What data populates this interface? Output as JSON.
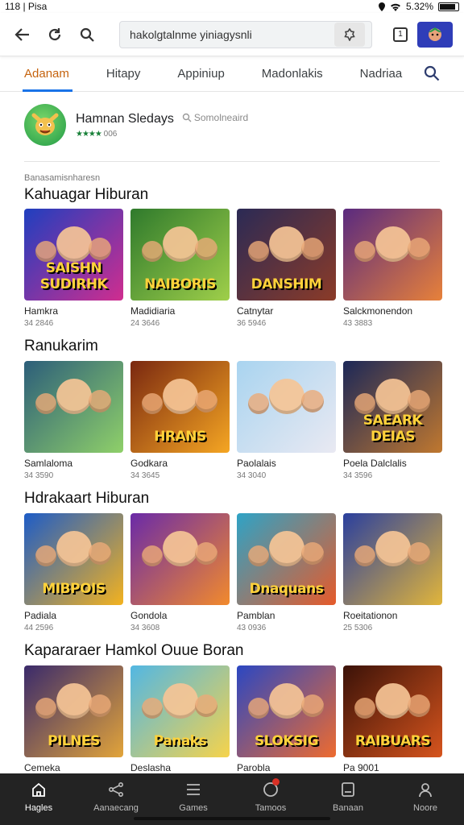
{
  "status_bar": {
    "time": "118 | Pisa",
    "battery": "5.32%"
  },
  "browser": {
    "url_text": "hakolgtalnme yiniagysnli",
    "tab_count": "1"
  },
  "tabs": [
    {
      "label": "Adanam"
    },
    {
      "label": "Hitapy"
    },
    {
      "label": "Appiniup"
    },
    {
      "label": "Madonlakis"
    },
    {
      "label": "Nadriaa"
    }
  ],
  "app": {
    "name": "Hamnan Sledays",
    "search_hint": "Somolneaird",
    "rating_count": "006"
  },
  "breadcrumb": "Banasamisnharesn",
  "sections": [
    {
      "title": "Kahuagar Hiburan",
      "items": [
        {
          "name": "Hamkra",
          "meta": "34 2846",
          "art": "SAISHN SUDIRHK",
          "bg1": "#1f3fbf",
          "bg2": "#d02d8f"
        },
        {
          "name": "Madidiaria",
          "meta": "24 3646",
          "art": "NAIBORIS",
          "bg1": "#2f7a2c",
          "bg2": "#9fcf4a"
        },
        {
          "name": "Catnytar",
          "meta": "36 5946",
          "art": "DANSHIM",
          "bg1": "#2b2a55",
          "bg2": "#8b3b28"
        },
        {
          "name": "Salckmonendon",
          "meta": "43 3883",
          "art": "",
          "bg1": "#5a2a7f",
          "bg2": "#e7813a"
        }
      ]
    },
    {
      "title": "Ranukarim",
      "items": [
        {
          "name": "Samlaloma",
          "meta": "34 3590",
          "art": "",
          "bg1": "#2c5e7a",
          "bg2": "#8fd069"
        },
        {
          "name": "Godkara",
          "meta": "34 3645",
          "art": "HRANS",
          "bg1": "#7a2810",
          "bg2": "#f5a623"
        },
        {
          "name": "Paolalais",
          "meta": "34 3040",
          "art": "",
          "bg1": "#a9d4f0",
          "bg2": "#e9e9f2"
        },
        {
          "name": "Poela Dalclalis",
          "meta": "34 3596",
          "art": "SAEARK DEIAS",
          "bg1": "#1c2858",
          "bg2": "#c0782f"
        }
      ]
    },
    {
      "title": "Hdrakaart Hiburan",
      "items": [
        {
          "name": "Padiala",
          "meta": "44 2596",
          "art": "MIBPOIS",
          "bg1": "#1d5cc7",
          "bg2": "#f3b21f"
        },
        {
          "name": "Gondola",
          "meta": "34 3608",
          "art": "",
          "bg1": "#6a2aa8",
          "bg2": "#f28a2c"
        },
        {
          "name": "Pamblan",
          "meta": "43 0936",
          "art": "Dnaquans",
          "bg1": "#2ea3c6",
          "bg2": "#e65a2a"
        },
        {
          "name": "Roeitationon",
          "meta": "25 5306",
          "art": "",
          "bg1": "#2a3f9e",
          "bg2": "#e1b53b"
        }
      ]
    },
    {
      "title": "Kapararaer Hamkol Ouue Boran",
      "items": [
        {
          "name": "Cemeka",
          "meta": "",
          "art": "PILNES",
          "bg1": "#3a2a6b",
          "bg2": "#e2a43a"
        },
        {
          "name": "Deslasha",
          "meta": "",
          "art": "Panaks",
          "bg1": "#52b7e3",
          "bg2": "#f6d34b"
        },
        {
          "name": "Parobla",
          "meta": "",
          "art": "SLOKSIG",
          "bg1": "#2b47c2",
          "bg2": "#ee6b2f"
        },
        {
          "name": "Pa 9001",
          "meta": "",
          "art": "RAIBUARS",
          "bg1": "#3b1208",
          "bg2": "#d6541d"
        }
      ]
    }
  ],
  "bottom_nav": [
    {
      "label": "Hagles",
      "icon": "home-icon"
    },
    {
      "label": "Aanaecang",
      "icon": "share-icon"
    },
    {
      "label": "Games",
      "icon": "list-icon"
    },
    {
      "label": "Tamoos",
      "icon": "clock-icon"
    },
    {
      "label": "Banaan",
      "icon": "book-icon"
    },
    {
      "label": "Noore",
      "icon": "person-icon"
    }
  ],
  "colors": {
    "active_tab": "#c5630e",
    "tab_indicator": "#1a73e8",
    "bottom_bar": "#232323"
  }
}
